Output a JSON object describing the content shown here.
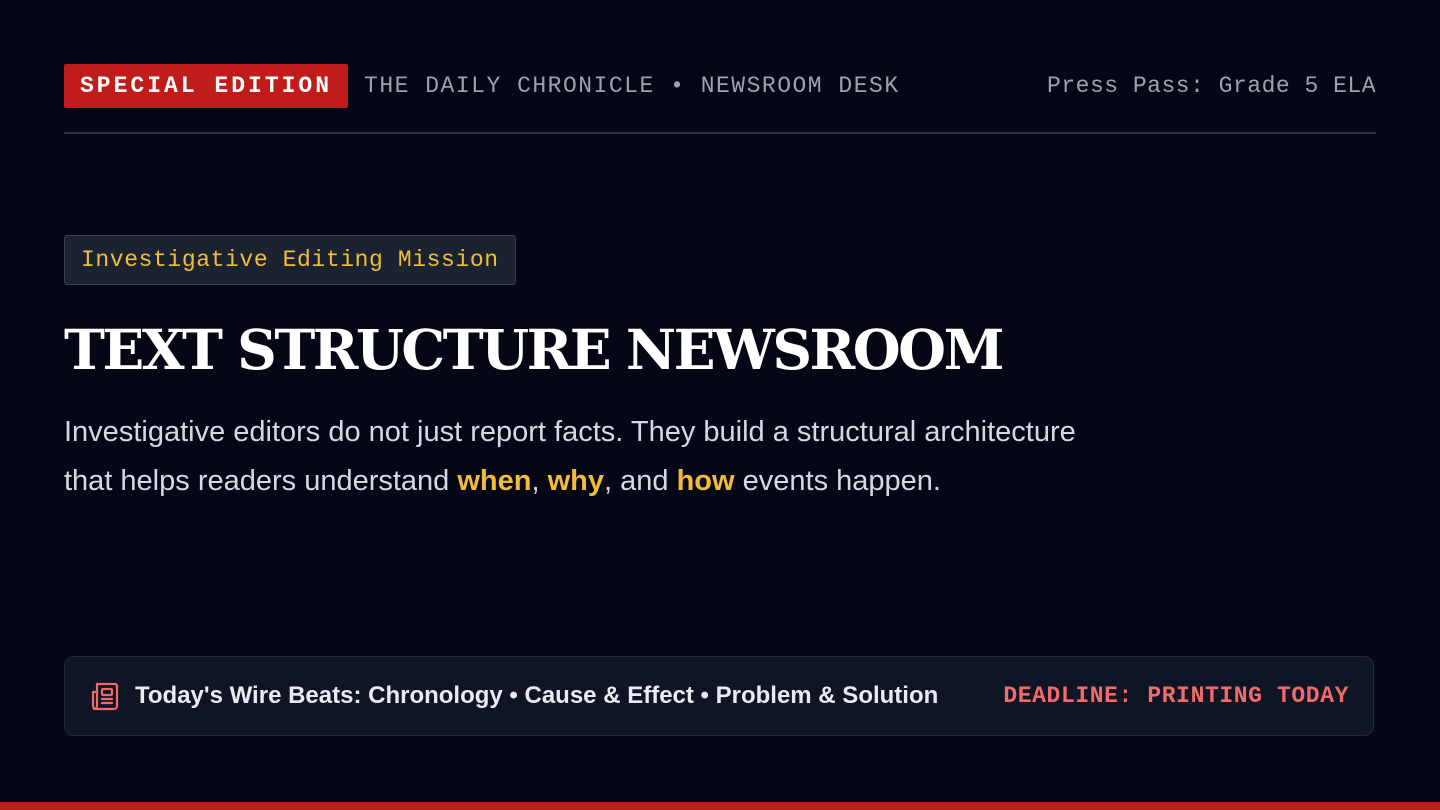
{
  "masthead": {
    "badge": "SPECIAL EDITION",
    "title": "THE DAILY CHRONICLE • NEWSROOM DESK",
    "press_pass": "Press Pass: Grade 5 ELA"
  },
  "hero": {
    "mission_tag": "Investigative Editing Mission",
    "headline": "TEXT STRUCTURE NEWSROOM",
    "lede_part1": "Investigative editors do not just report facts. They build a structural architecture that helps readers understand ",
    "hl_when": "when",
    "sep1": ", ",
    "hl_why": "why",
    "sep2": ", and ",
    "hl_how": "how",
    "lede_part2": " events happen."
  },
  "wire": {
    "icon": "newspaper-icon",
    "text": "Today's Wire Beats: Chronology • Cause & Effect • Problem & Solution",
    "deadline": "DEADLINE: PRINTING TODAY"
  },
  "colors": {
    "background": "#050714",
    "accent_red": "#c01c1c",
    "highlight_gold": "#f3bb3a",
    "deadline_red": "#f26a6a"
  }
}
